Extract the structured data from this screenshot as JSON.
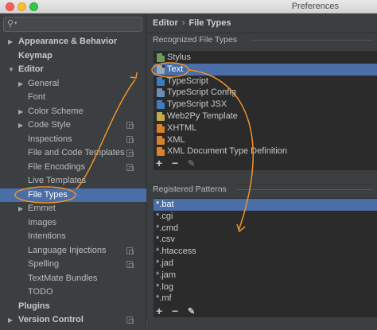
{
  "window": {
    "title": "Preferences"
  },
  "search": {
    "placeholder": ""
  },
  "sidebar": {
    "items": [
      {
        "label": "Appearance & Behavior",
        "bold": true,
        "arrow": "right",
        "indent": 0,
        "copy": false
      },
      {
        "label": "Keymap",
        "bold": true,
        "arrow": "",
        "indent": 0,
        "copy": false
      },
      {
        "label": "Editor",
        "bold": true,
        "arrow": "down",
        "indent": 0,
        "copy": false
      },
      {
        "label": "General",
        "bold": false,
        "arrow": "right",
        "indent": 1,
        "copy": false
      },
      {
        "label": "Font",
        "bold": false,
        "arrow": "",
        "indent": 1,
        "copy": false
      },
      {
        "label": "Color Scheme",
        "bold": false,
        "arrow": "right",
        "indent": 1,
        "copy": false
      },
      {
        "label": "Code Style",
        "bold": false,
        "arrow": "right",
        "indent": 1,
        "copy": true
      },
      {
        "label": "Inspections",
        "bold": false,
        "arrow": "",
        "indent": 1,
        "copy": true
      },
      {
        "label": "File and Code Templates",
        "bold": false,
        "arrow": "",
        "indent": 1,
        "copy": true
      },
      {
        "label": "File Encodings",
        "bold": false,
        "arrow": "",
        "indent": 1,
        "copy": true
      },
      {
        "label": "Live Templates",
        "bold": false,
        "arrow": "",
        "indent": 1,
        "copy": false
      },
      {
        "label": "File Types",
        "bold": false,
        "arrow": "",
        "indent": 1,
        "copy": false,
        "selected": true
      },
      {
        "label": "Emmet",
        "bold": false,
        "arrow": "right",
        "indent": 1,
        "copy": false
      },
      {
        "label": "Images",
        "bold": false,
        "arrow": "",
        "indent": 1,
        "copy": false
      },
      {
        "label": "Intentions",
        "bold": false,
        "arrow": "",
        "indent": 1,
        "copy": false
      },
      {
        "label": "Language Injections",
        "bold": false,
        "arrow": "",
        "indent": 1,
        "copy": true
      },
      {
        "label": "Spelling",
        "bold": false,
        "arrow": "",
        "indent": 1,
        "copy": true
      },
      {
        "label": "TextMate Bundles",
        "bold": false,
        "arrow": "",
        "indent": 1,
        "copy": false
      },
      {
        "label": "TODO",
        "bold": false,
        "arrow": "",
        "indent": 1,
        "copy": false
      },
      {
        "label": "Plugins",
        "bold": true,
        "arrow": "",
        "indent": 0,
        "copy": false
      },
      {
        "label": "Version Control",
        "bold": true,
        "arrow": "right",
        "indent": 0,
        "copy": true
      }
    ]
  },
  "breadcrumb": {
    "parent": "Editor",
    "separator": "›",
    "current": "File Types"
  },
  "recognized": {
    "title": "Recognized File Types",
    "items": [
      {
        "label": "Stylus",
        "icon": "stylus-file-icon",
        "color": "#6f9a5a"
      },
      {
        "label": "Text",
        "icon": "text-file-icon",
        "color": "#9aa7b0",
        "selected": true
      },
      {
        "label": "TypeScript",
        "icon": "typescript-file-icon",
        "color": "#3c7dbf"
      },
      {
        "label": "TypeScript Config",
        "icon": "tsconfig-file-icon",
        "color": "#6a8fb5"
      },
      {
        "label": "TypeScript JSX",
        "icon": "tsx-file-icon",
        "color": "#3c7dbf"
      },
      {
        "label": "Web2Py Template",
        "icon": "web2py-file-icon",
        "color": "#c9a84a"
      },
      {
        "label": "XHTML",
        "icon": "xhtml-file-icon",
        "color": "#d9822b"
      },
      {
        "label": "XML",
        "icon": "xml-file-icon",
        "color": "#d9822b"
      },
      {
        "label": "XML Document Type Definition",
        "icon": "dtd-file-icon",
        "color": "#d9822b"
      }
    ],
    "toolbar": {
      "add": "+",
      "remove": "−",
      "edit": "✎"
    }
  },
  "patterns": {
    "title": "Registered Patterns",
    "items": [
      "*.bat",
      "*.cgi",
      "*.cmd",
      "*.csv",
      "*.htaccess",
      "*.jad",
      "*.jam",
      "*.log",
      "*.mf"
    ],
    "selected_index": 0,
    "toolbar": {
      "add": "+",
      "remove": "−",
      "edit": "✎"
    }
  },
  "colors": {
    "selection": "#4a6ea8",
    "annotation": "#f0932b"
  }
}
